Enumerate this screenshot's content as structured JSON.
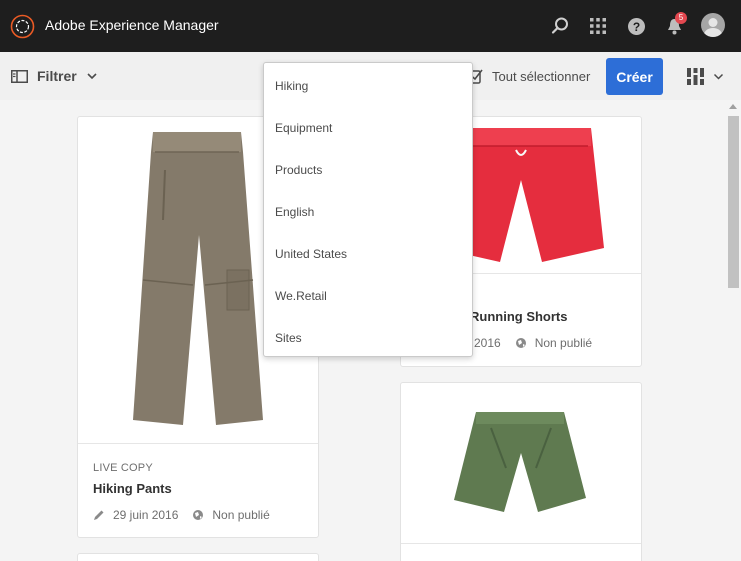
{
  "app": {
    "title": "Adobe Experience Manager",
    "notification_count": "5"
  },
  "toolbar": {
    "filter_label": "Filtrer",
    "select_all_label": "Tout sélectionner",
    "create_label": "Créer"
  },
  "breadcrumb_menu": {
    "items": [
      "Hiking",
      "Equipment",
      "Products",
      "English",
      "United States",
      "We.Retail",
      "Sites"
    ]
  },
  "cards": [
    {
      "subtitle": "LIVE COPY",
      "title": "Hiking Pants",
      "modified": "29 juin 2016",
      "status": "Non publié",
      "image": "grey hiking pants"
    },
    {
      "title": "Running Shorts",
      "modified": "2016",
      "status": "Non publié",
      "image": "red running shorts"
    },
    {
      "image": "green shorts"
    }
  ],
  "colors": {
    "topbar": "#1e1e1e",
    "accent": "#2d6ed7",
    "badge": "#e34850",
    "logo": "#eb5b25"
  },
  "icons": [
    "search-icon",
    "apps-grid-icon",
    "help-icon",
    "bell-icon",
    "avatar",
    "filter-panel-icon",
    "select-all-icon",
    "view-switch-icon",
    "pencil-icon",
    "globe-icon"
  ]
}
